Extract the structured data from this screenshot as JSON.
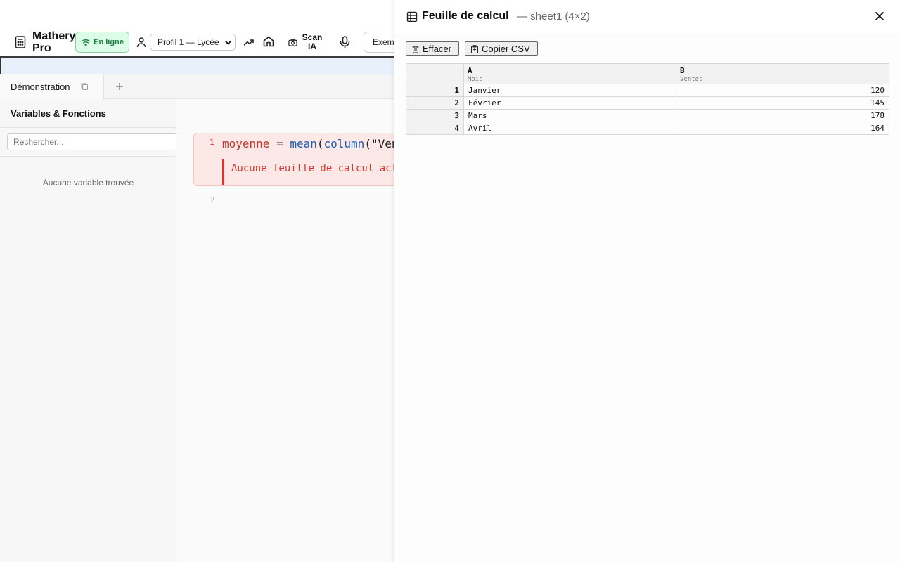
{
  "app": {
    "title": "Mathery Pro",
    "status": "En ligne",
    "profile": "Profil 1 — Lycée",
    "scan_label": "Scan IA",
    "examples_label": "Exemples",
    "accent_color": "#15803d",
    "icons": [
      "calculator-icon",
      "wifi-icon",
      "user-icon",
      "trend-icon",
      "home-icon",
      "camera-icon",
      "mic-icon"
    ]
  },
  "tabs": [
    {
      "label": "Démonstration"
    }
  ],
  "sidebar": {
    "title": "Variables & Fonctions",
    "search_placeholder": "Rechercher...",
    "empty_text": "Aucune variable trouvée"
  },
  "editor": {
    "lines": [
      {
        "number": "1",
        "var": "moyenne",
        "op": " = ",
        "fn1": "mean",
        "p1": "(",
        "fn2": "column",
        "rest": "(\"Ventes\"))",
        "error": "Aucune feuille de calcul active"
      },
      {
        "number": "2"
      }
    ],
    "error_color": "#dd3333"
  },
  "sheet": {
    "title": "Feuille de calcul",
    "subtitle": "— sheet1 (4×2)",
    "clear_label": "Effacer",
    "copy_label": "Copier CSV",
    "columns": [
      {
        "letter": "A",
        "name": "Mois"
      },
      {
        "letter": "B",
        "name": "Ventes"
      }
    ],
    "rows": [
      {
        "n": "1",
        "a": "Janvier",
        "b": "120"
      },
      {
        "n": "2",
        "a": "Février",
        "b": "145"
      },
      {
        "n": "3",
        "a": "Mars",
        "b": "178"
      },
      {
        "n": "4",
        "a": "Avril",
        "b": "164"
      }
    ]
  }
}
